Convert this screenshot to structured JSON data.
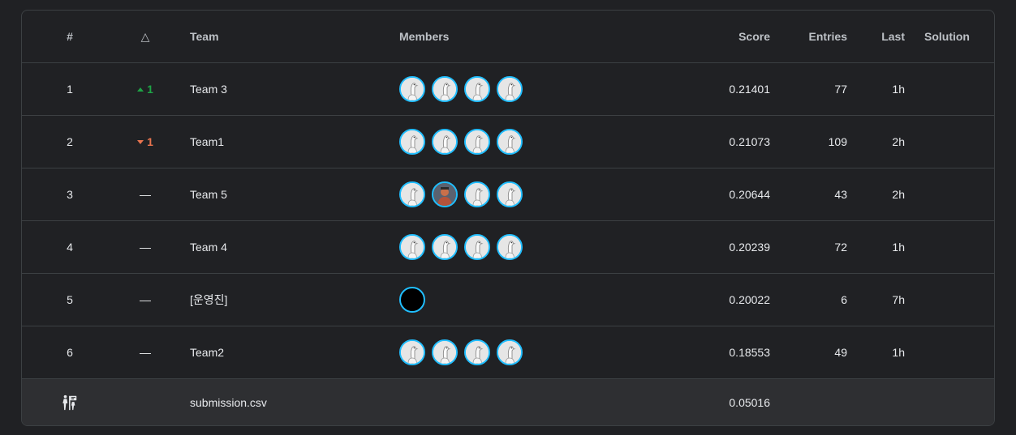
{
  "header": {
    "rank": "#",
    "delta": "△",
    "team": "Team",
    "members": "Members",
    "score": "Score",
    "entries": "Entries",
    "last": "Last",
    "solution": "Solution"
  },
  "rows": [
    {
      "rank": "1",
      "delta": {
        "dir": "up",
        "value": "1"
      },
      "team": "Team 3",
      "members": [
        "default-avatar",
        "default-avatar",
        "default-avatar",
        "default-avatar"
      ],
      "score": "0.21401",
      "entries": "77",
      "last": "1h"
    },
    {
      "rank": "2",
      "delta": {
        "dir": "down",
        "value": "1"
      },
      "team": "Team1",
      "members": [
        "default-avatar",
        "default-avatar",
        "default-avatar",
        "default-avatar"
      ],
      "score": "0.21073",
      "entries": "109",
      "last": "2h"
    },
    {
      "rank": "3",
      "delta": {
        "dir": "none",
        "value": "—"
      },
      "team": "Team 5",
      "members": [
        "default-avatar",
        "photo-avatar",
        "default-avatar",
        "default-avatar"
      ],
      "score": "0.20644",
      "entries": "43",
      "last": "2h"
    },
    {
      "rank": "4",
      "delta": {
        "dir": "none",
        "value": "—"
      },
      "team": "Team 4",
      "members": [
        "default-avatar",
        "default-avatar",
        "default-avatar",
        "default-avatar"
      ],
      "score": "0.20239",
      "entries": "72",
      "last": "1h"
    },
    {
      "rank": "5",
      "delta": {
        "dir": "none",
        "value": "—"
      },
      "team": "[운영진]",
      "members": [
        "dark-avatar"
      ],
      "score": "0.20022",
      "entries": "6",
      "last": "7h"
    },
    {
      "rank": "6",
      "delta": {
        "dir": "none",
        "value": "—"
      },
      "team": "Team2",
      "members": [
        "default-avatar",
        "default-avatar",
        "default-avatar",
        "default-avatar"
      ],
      "score": "0.18553",
      "entries": "49",
      "last": "1h"
    }
  ],
  "footer": {
    "icon": "benchmark-icon",
    "team": "submission.csv",
    "score": "0.05016"
  },
  "colors": {
    "background": "#202124",
    "border": "#3c4043",
    "footer_bg": "#2e2f32",
    "up": "#1ea446",
    "down": "#e8744f",
    "avatar_ring": "#20beff"
  }
}
